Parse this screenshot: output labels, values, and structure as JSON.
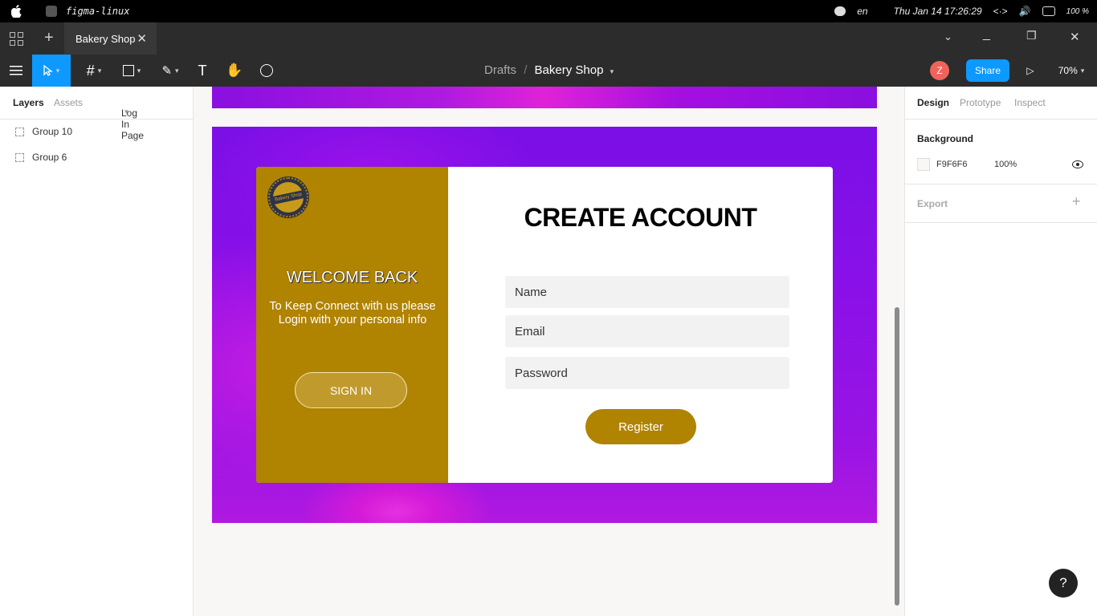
{
  "system_bar": {
    "app_name": "figma-linux",
    "language": "en",
    "datetime": "Thu Jan 14  17:26:29",
    "battery": "100 %"
  },
  "tab_bar": {
    "tab_title": "Bakery Shop"
  },
  "toolbar": {
    "breadcrumb_parent": "Drafts",
    "breadcrumb_separator": "/",
    "file_name": "Bakery Shop",
    "avatar_initial": "Z",
    "share_label": "Share",
    "zoom": "70%"
  },
  "left_panel": {
    "tabs": [
      "Layers",
      "Assets"
    ],
    "page_selector": "Log In Page",
    "layers": [
      "Group 10",
      "Group 6"
    ]
  },
  "design": {
    "brand_badge": "Bakery Shop",
    "welcome_title": "WELCOME BACK",
    "welcome_sub_line1": "To Keep Connect with us please",
    "welcome_sub_line2": "Login with your personal info",
    "signin_label": "SIGN IN",
    "create_title": "CREATE ACCOUNT",
    "name_placeholder": "Name",
    "email_placeholder": "Email",
    "password_placeholder": "Password",
    "register_label": "Register",
    "accent_color": "#b08300"
  },
  "right_panel": {
    "tabs": [
      "Design",
      "Prototype",
      "Inspect"
    ],
    "background_heading": "Background",
    "bg_color": "F9F6F6",
    "bg_opacity": "100%",
    "export_heading": "Export"
  },
  "help_label": "?"
}
